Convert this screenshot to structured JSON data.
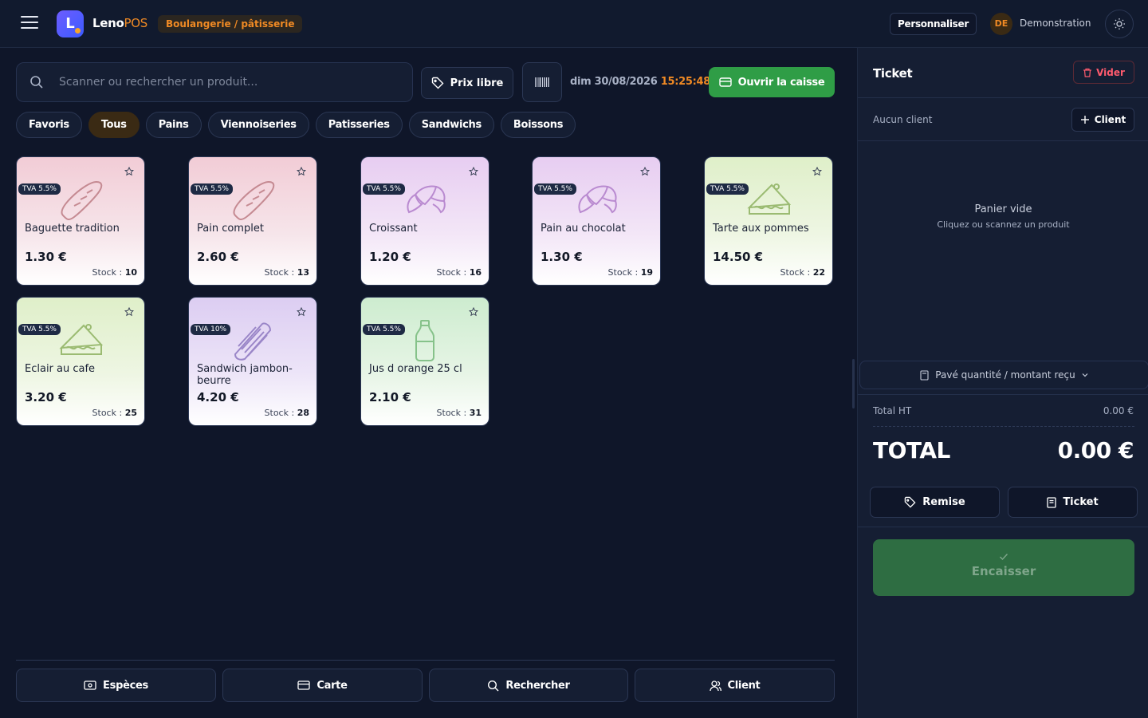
{
  "app": {
    "brand_main": "Leno",
    "brand_accent": "POS",
    "logo_letter": "L",
    "business_type": "Boulangerie / pâtisserie",
    "customize_label": "Personnaliser",
    "user_initials": "DE",
    "user_name": "Demonstration"
  },
  "toolbar": {
    "search_placeholder": "Scanner ou rechercher un produit...",
    "free_price_label": "Prix libre",
    "date": "dim 30/08/2026",
    "time": "15:25:48",
    "open_register_label": "Ouvrir la caisse"
  },
  "categories": [
    "Favoris",
    "Tous",
    "Pains",
    "Viennoiseries",
    "Patisseries",
    "Sandwichs",
    "Boissons"
  ],
  "active_category": "Tous",
  "stock_label": "Stock :",
  "products": [
    {
      "name": "Baguette tradition",
      "price": "1.30 €",
      "stock": "10",
      "tva": "TVA 5.5%",
      "icon": "baguette-icon",
      "color": "rose"
    },
    {
      "name": "Pain complet",
      "price": "2.60 €",
      "stock": "13",
      "tva": "TVA 5.5%",
      "icon": "baguette-icon",
      "color": "rose"
    },
    {
      "name": "Croissant",
      "price": "1.20 €",
      "stock": "16",
      "tva": "TVA 5.5%",
      "icon": "croissant-icon",
      "color": "lilac"
    },
    {
      "name": "Pain au chocolat",
      "price": "1.30 €",
      "stock": "19",
      "tva": "TVA 5.5%",
      "icon": "croissant-icon",
      "color": "lilac"
    },
    {
      "name": "Tarte aux pommes",
      "price": "14.50 €",
      "stock": "22",
      "tva": "TVA 5.5%",
      "icon": "pie-slice-icon",
      "color": "lime"
    },
    {
      "name": "Eclair au cafe",
      "price": "3.20 €",
      "stock": "25",
      "tva": "TVA 5.5%",
      "icon": "pie-slice-icon",
      "color": "lime"
    },
    {
      "name": "Sandwich jambon-beurre",
      "price": "4.20 €",
      "stock": "28",
      "tva": "TVA 10%",
      "icon": "sandwich-icon",
      "color": "purple"
    },
    {
      "name": "Jus d orange 25 cl",
      "price": "2.10 €",
      "stock": "31",
      "tva": "TVA 5.5%",
      "icon": "bottle-icon",
      "color": "green"
    }
  ],
  "bottom_actions": {
    "cash": "Espèces",
    "card": "Carte",
    "search": "Rechercher",
    "client": "Client"
  },
  "ticket": {
    "title": "Ticket",
    "clear_label": "Vider",
    "no_client": "Aucun client",
    "client_button": "Client",
    "empty_title": "Panier vide",
    "empty_subtitle": "Cliquez ou scannez un produit",
    "keypad_label": "Pavé quantité / montant reçu",
    "total_ht_label": "Total HT",
    "total_ht_value": "0.00 €",
    "total_label": "TOTAL",
    "total_value": "0.00 €",
    "discount_label": "Remise",
    "ticket_button": "Ticket",
    "checkout_label": "Encaisser"
  },
  "colors": {
    "accent_orange": "#f08a24",
    "success_green": "#2f9d46",
    "danger_red": "#ff5b6e",
    "background": "#0f1629",
    "panel": "#151e33"
  }
}
